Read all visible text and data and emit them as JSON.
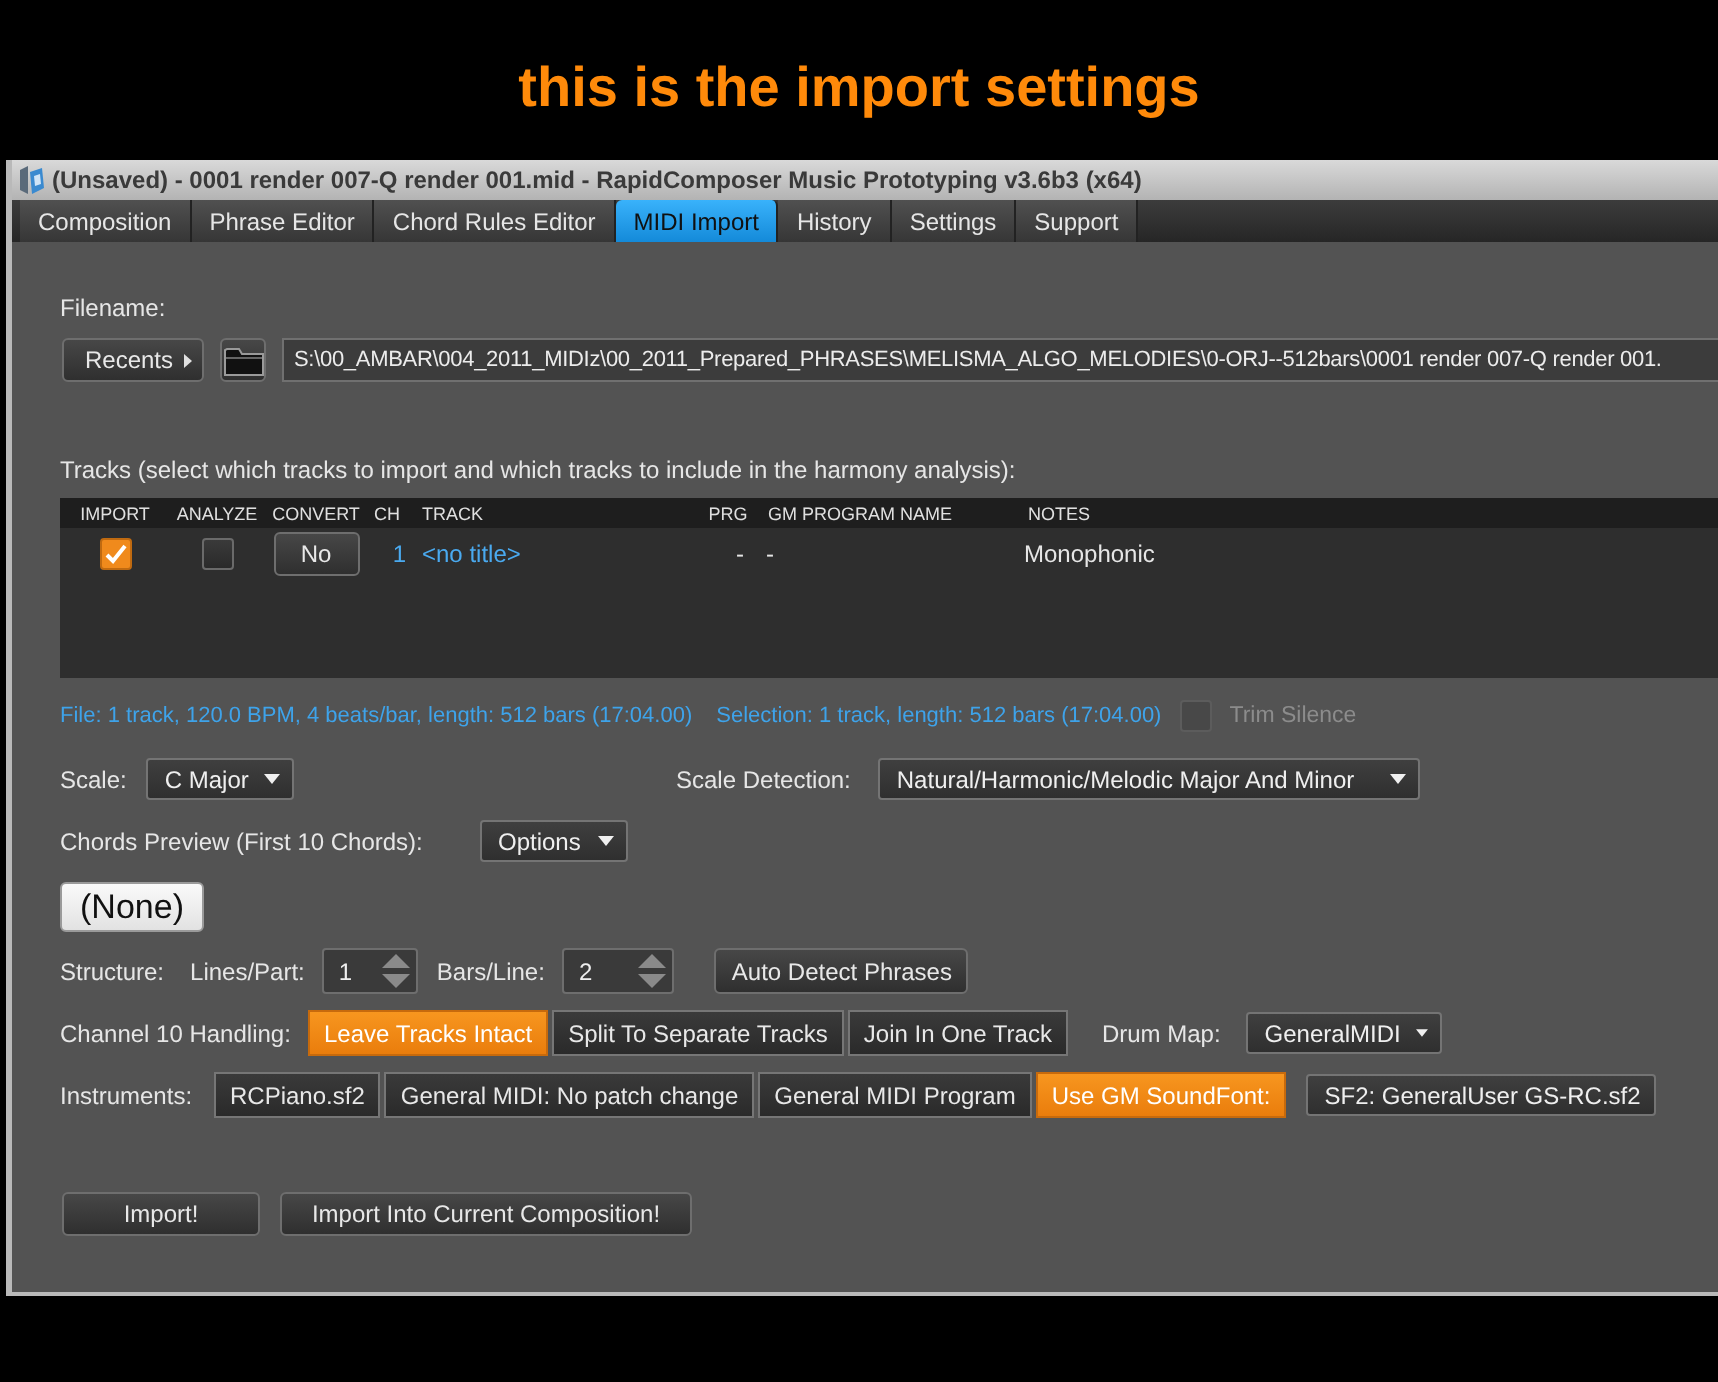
{
  "caption": "this is the import settings",
  "window": {
    "title": "(Unsaved) - 0001 render 007-Q render 001.mid - RapidComposer Music Prototyping v3.6b3 (x64)"
  },
  "tabs": [
    {
      "label": "Composition",
      "selected": false
    },
    {
      "label": "Phrase Editor",
      "selected": false
    },
    {
      "label": "Chord Rules Editor",
      "selected": false
    },
    {
      "label": "MIDI Import",
      "selected": true
    },
    {
      "label": "History",
      "selected": false
    },
    {
      "label": "Settings",
      "selected": false
    },
    {
      "label": "Support",
      "selected": false
    }
  ],
  "filename": {
    "label": "Filename:",
    "recents_button": "Recents",
    "path": "S:\\00_AMBAR\\004_2011_MIDIz\\00_2011_Prepared_PHRASES\\MELISMA_ALGO_MELODIES\\0-ORJ--512bars\\0001 render 007-Q render 001."
  },
  "tracks": {
    "label": "Tracks (select which tracks to import and which tracks to include in the harmony analysis):",
    "columns": [
      "IMPORT",
      "ANALYZE",
      "CONVERT",
      "CH",
      "TRACK",
      "PRG",
      "GM PROGRAM NAME",
      "NOTES"
    ],
    "rows": [
      {
        "import": true,
        "analyze": false,
        "convert": "No",
        "ch": "1",
        "track": "<no title>",
        "prg": "-",
        "gm_program_name": "-",
        "notes": "Monophonic"
      }
    ]
  },
  "file_info": "File: 1 track, 120.0 BPM, 4 beats/bar, length: 512 bars (17:04.00)",
  "selection_info": "Selection: 1 track, length: 512 bars (17:04.00)",
  "trim_silence": {
    "label": "Trim Silence",
    "checked": false,
    "disabled": true
  },
  "scale": {
    "label": "Scale:",
    "value": "C Major"
  },
  "scale_detection": {
    "label": "Scale Detection:",
    "value": "Natural/Harmonic/Melodic Major And Minor"
  },
  "chords_preview": {
    "label": "Chords Preview (First 10 Chords):",
    "options_button": "Options",
    "chord": "(None)"
  },
  "structure": {
    "label": "Structure:",
    "lines_per_part": {
      "label": "Lines/Part:",
      "value": "1"
    },
    "bars_per_line": {
      "label": "Bars/Line:",
      "value": "2"
    },
    "auto_detect_button": "Auto Detect Phrases"
  },
  "channel_10_handling": {
    "label": "Channel 10 Handling:",
    "options": [
      {
        "label": "Leave Tracks Intact",
        "selected": true
      },
      {
        "label": "Split To Separate Tracks",
        "selected": false
      },
      {
        "label": "Join In One Track",
        "selected": false
      }
    ],
    "drum_map": {
      "label": "Drum Map:",
      "value": "GeneralMIDI"
    }
  },
  "instruments": {
    "label": "Instruments:",
    "options": [
      {
        "label": "RCPiano.sf2",
        "selected": false
      },
      {
        "label": "General MIDI: No patch change",
        "selected": false
      },
      {
        "label": "General MIDI Program",
        "selected": false
      },
      {
        "label": "Use GM SoundFont:",
        "selected": true
      }
    ],
    "soundfont": "SF2: GeneralUser GS-RC.sf2"
  },
  "actions": [
    "Import!",
    "Import Into Current Composition!"
  ]
}
